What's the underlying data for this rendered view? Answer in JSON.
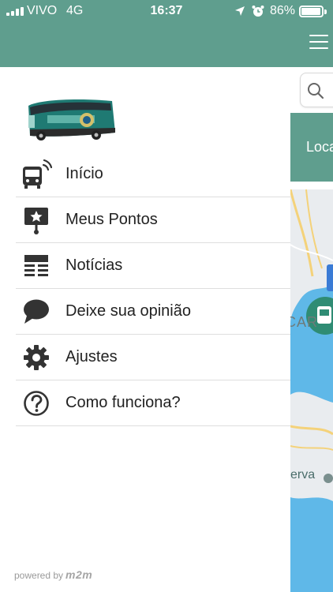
{
  "status_bar": {
    "carrier": "VIVO",
    "network": "4G",
    "time": "16:37",
    "battery_percent": "86%",
    "icons": [
      "signal-icon",
      "location-arrow-icon",
      "alarm-icon",
      "battery-icon"
    ]
  },
  "drawer": {
    "logo": "bus-logo-image",
    "menu": [
      {
        "label": "Início",
        "icon": "bus-signal-icon"
      },
      {
        "label": "Meus Pontos",
        "icon": "star-stop-icon"
      },
      {
        "label": "Notícias",
        "icon": "news-icon"
      },
      {
        "label": "Deixe sua opinião",
        "icon": "chat-bubble-icon"
      },
      {
        "label": "Ajustes",
        "icon": "gear-icon"
      },
      {
        "label": "Como funciona?",
        "icon": "question-icon"
      }
    ],
    "footer": {
      "powered_by": "powered by",
      "brand": "m2m"
    }
  },
  "background_app": {
    "menu_icon": "hamburger-icon",
    "search_icon": "search-icon",
    "band_label": "Loca",
    "map_label": "erva",
    "map_partial_label": "CAR"
  },
  "colors": {
    "header": "#5f9e8e",
    "water": "#5fb8e8",
    "land": "#e9ecef",
    "text": "#222222",
    "icon": "#333333"
  }
}
